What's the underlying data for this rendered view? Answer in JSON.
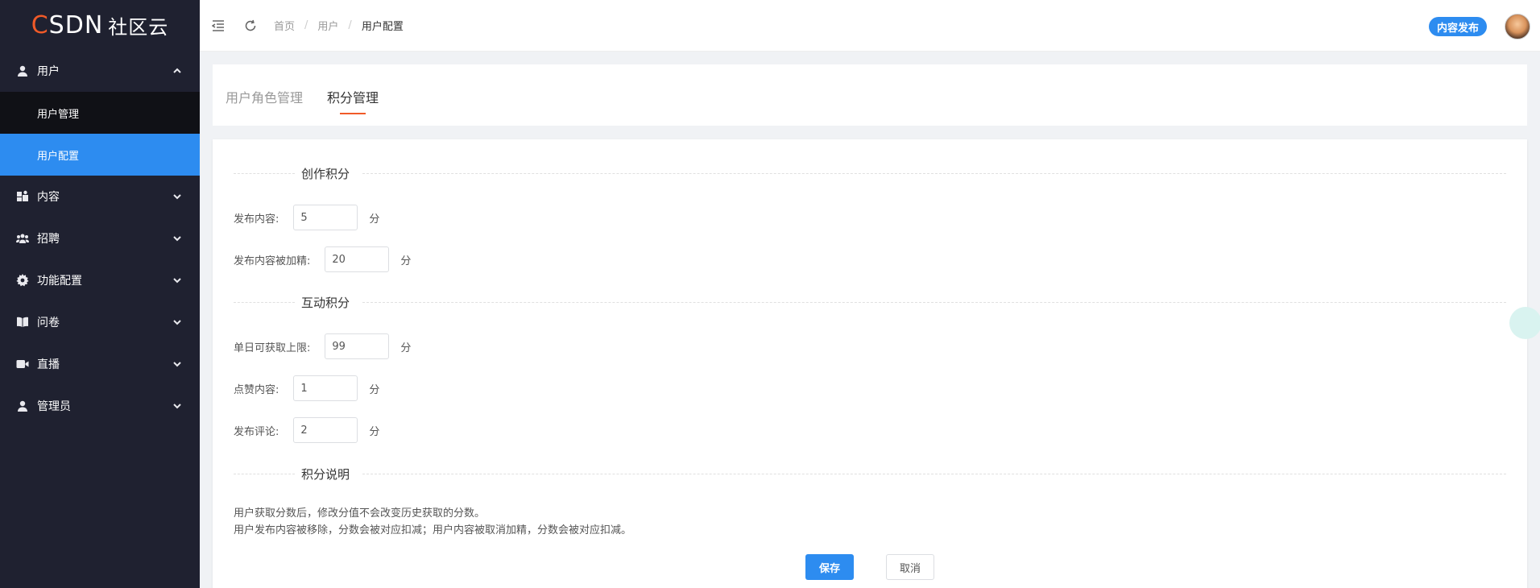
{
  "logo": {
    "c": "C",
    "sdn": "SDN",
    "brand": "社区云"
  },
  "sidebar": {
    "groups": [
      {
        "label": "用户",
        "icon": "user-icon",
        "expanded": true,
        "children": [
          {
            "label": "用户管理"
          },
          {
            "label": "用户配置",
            "active": true
          }
        ]
      },
      {
        "label": "内容",
        "icon": "content-icon"
      },
      {
        "label": "招聘",
        "icon": "team-icon"
      },
      {
        "label": "功能配置",
        "icon": "gear-icon"
      },
      {
        "label": "问卷",
        "icon": "book-icon"
      },
      {
        "label": "直播",
        "icon": "video-icon"
      },
      {
        "label": "管理员",
        "icon": "admin-icon"
      }
    ]
  },
  "header": {
    "breadcrumb": [
      "首页",
      "用户",
      "用户配置"
    ],
    "separator": "/",
    "publish_label": "内容发布"
  },
  "tabs": [
    {
      "label": "用户角色管理",
      "active": false
    },
    {
      "label": "积分管理",
      "active": true
    }
  ],
  "form": {
    "sections": {
      "create": "创作积分",
      "interact": "互动积分",
      "desc": "积分说明"
    },
    "fields": [
      {
        "label": "发布内容:",
        "value": "5",
        "unit": "分"
      },
      {
        "label": "发布内容被加精:",
        "value": "20",
        "unit": "分"
      },
      {
        "label": "单日可获取上限:",
        "value": "99",
        "unit": "分"
      },
      {
        "label": "点赞内容:",
        "value": "1",
        "unit": "分"
      },
      {
        "label": "发布评论:",
        "value": "2",
        "unit": "分"
      }
    ],
    "notes": [
      "用户获取分数后，修改分值不会改变历史获取的分数。",
      "用户发布内容被移除，分数会被对应扣减；用户内容被取消加精，分数会被对应扣减。"
    ],
    "save_label": "保存",
    "cancel_label": "取消"
  },
  "colors": {
    "sidebar_bg": "#1f2130",
    "accent": "#2d8cf0",
    "brand_orange": "#f05a28"
  }
}
